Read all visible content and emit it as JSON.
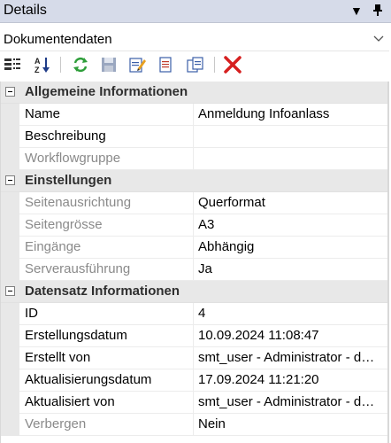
{
  "panel": {
    "title": "Details"
  },
  "selector": {
    "value": "Dokumentendaten"
  },
  "toolbar": {
    "buttons": [
      {
        "name": "categorized-view-icon"
      },
      {
        "name": "alphabetical-sort-icon"
      },
      {
        "name": "refresh-icon"
      },
      {
        "name": "save-icon"
      },
      {
        "name": "edit-icon"
      },
      {
        "name": "document-icon"
      },
      {
        "name": "copy-icon"
      },
      {
        "name": "delete-icon"
      }
    ]
  },
  "sections": [
    {
      "title": "Allgemeine Informationen",
      "rows": [
        {
          "name": "Name",
          "value": "Anmeldung Infoanlass",
          "readonly": false
        },
        {
          "name": "Beschreibung",
          "value": "",
          "readonly": false
        },
        {
          "name": "Workflowgruppe",
          "value": "",
          "readonly": true
        }
      ]
    },
    {
      "title": "Einstellungen",
      "rows": [
        {
          "name": "Seitenausrichtung",
          "value": "Querformat",
          "readonly": true
        },
        {
          "name": "Seitengrösse",
          "value": "A3",
          "readonly": true
        },
        {
          "name": "Eingänge",
          "value": "Abhängig",
          "readonly": true
        },
        {
          "name": "Serverausführung",
          "value": "Ja",
          "readonly": true
        }
      ]
    },
    {
      "title": "Datensatz Informationen",
      "rows": [
        {
          "name": "ID",
          "value": "4",
          "readonly": false
        },
        {
          "name": "Erstellungsdatum",
          "value": "10.09.2024 11:08:47",
          "readonly": false
        },
        {
          "name": "Erstellt von",
          "value": "smt_user - Administrator - d…",
          "readonly": false
        },
        {
          "name": "Aktualisierungsdatum",
          "value": "17.09.2024 11:21:20",
          "readonly": false
        },
        {
          "name": "Aktualisiert von",
          "value": "smt_user - Administrator - d…",
          "readonly": false
        },
        {
          "name": "Verbergen",
          "value": "Nein",
          "readonly": true
        }
      ]
    }
  ]
}
